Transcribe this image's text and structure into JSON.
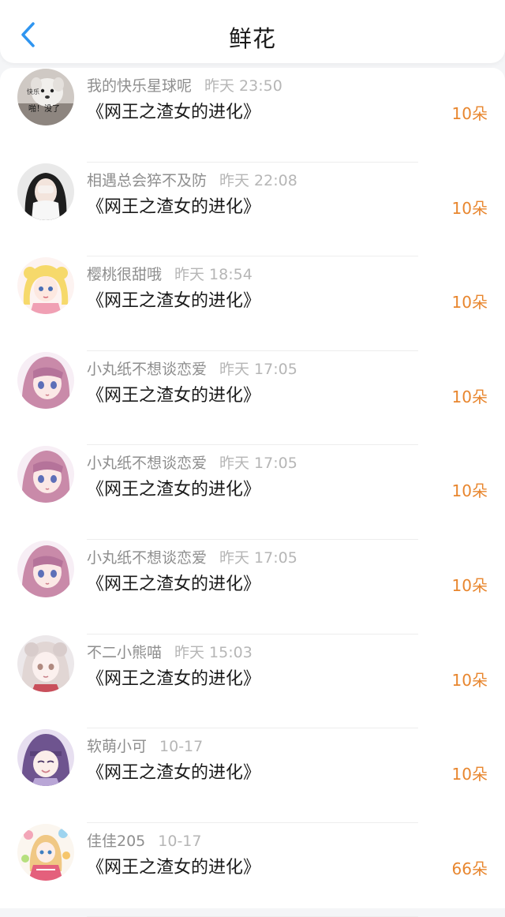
{
  "header": {
    "title": "鲜花",
    "back_icon": "chevron-left-icon",
    "accent": "#2f95f0"
  },
  "rows": [
    {
      "name": "我的快乐星球呢",
      "time": "昨天 23:50",
      "book": "《网王之渣女的进化》",
      "count": "10朵",
      "avatar_text_top": "快乐",
      "avatar_text_bottom": "啪！没了"
    },
    {
      "name": "相遇总会猝不及防",
      "time": "昨天 22:08",
      "book": "《网王之渣女的进化》",
      "count": "10朵"
    },
    {
      "name": "樱桃很甜哦",
      "time": "昨天 18:54",
      "book": "《网王之渣女的进化》",
      "count": "10朵"
    },
    {
      "name": "小丸纸不想谈恋爱",
      "time": "昨天 17:05",
      "book": "《网王之渣女的进化》",
      "count": "10朵"
    },
    {
      "name": "小丸纸不想谈恋爱",
      "time": "昨天 17:05",
      "book": "《网王之渣女的进化》",
      "count": "10朵"
    },
    {
      "name": "小丸纸不想谈恋爱",
      "time": "昨天 17:05",
      "book": "《网王之渣女的进化》",
      "count": "10朵"
    },
    {
      "name": "不二小熊喵",
      "time": "昨天 15:03",
      "book": "《网王之渣女的进化》",
      "count": "10朵"
    },
    {
      "name": "软萌小可",
      "time": "10-17",
      "book": "《网王之渣女的进化》",
      "count": "10朵"
    },
    {
      "name": "佳佳205",
      "time": "10-17",
      "book": "《网王之渣女的进化》",
      "count": "66朵"
    }
  ],
  "colors": {
    "count": "#e8862e",
    "name": "#8e8e8e",
    "time": "#b6b6b6"
  }
}
